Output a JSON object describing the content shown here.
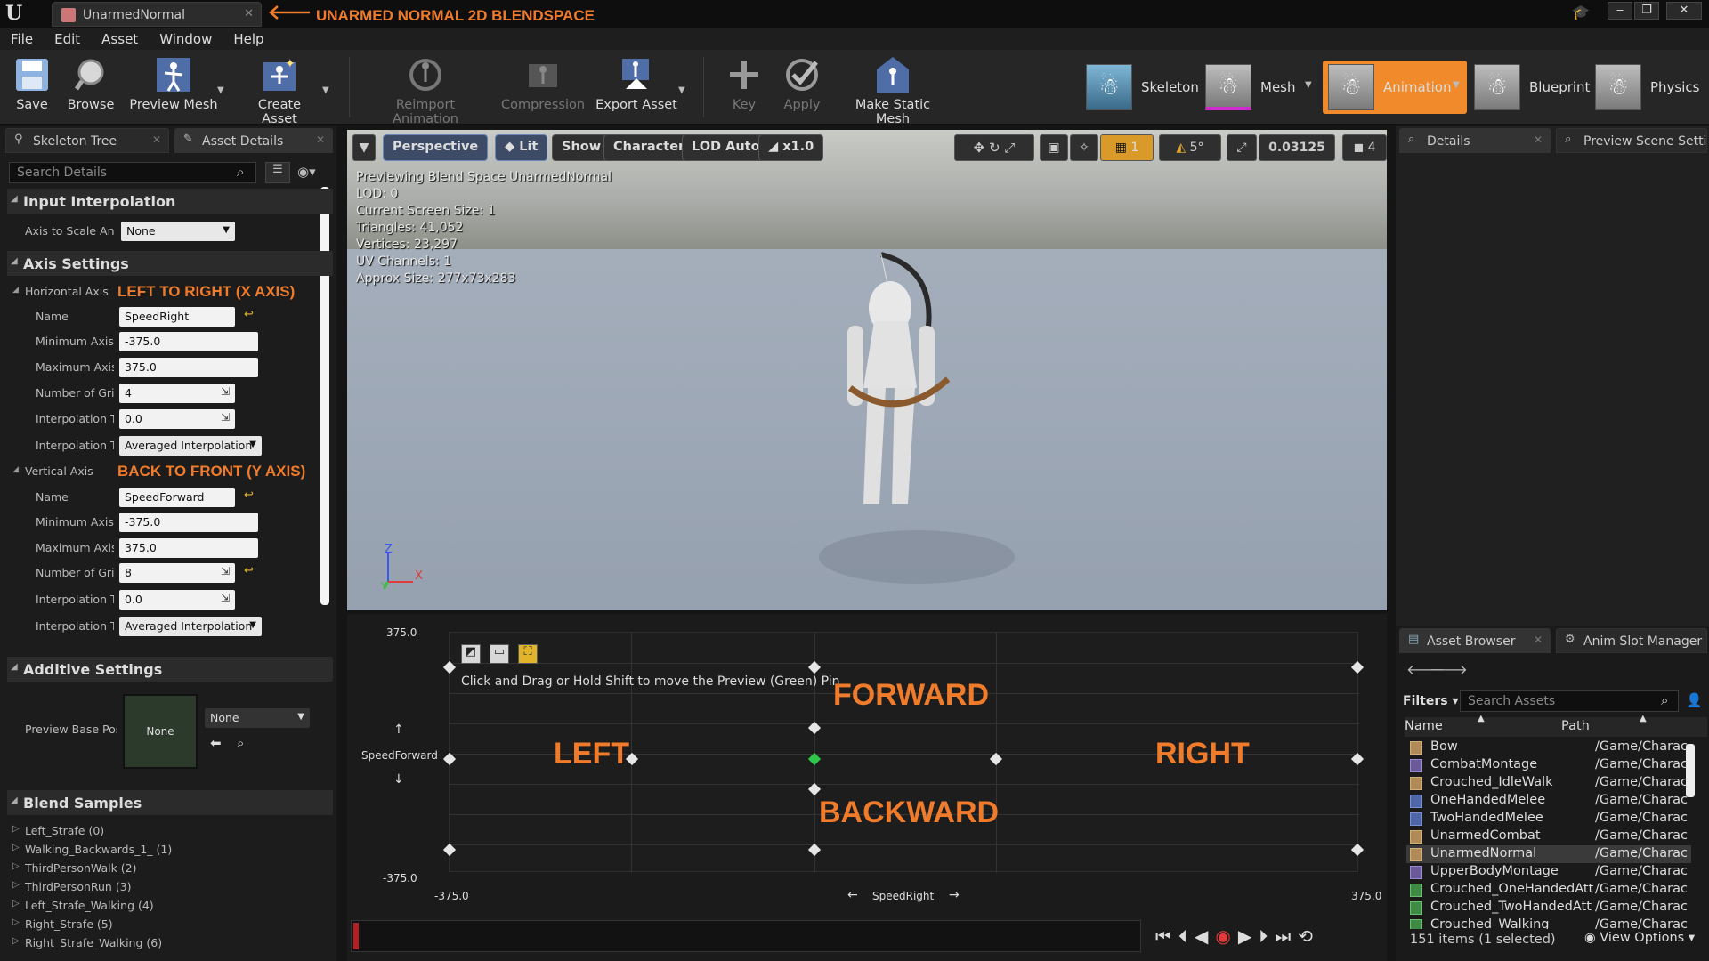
{
  "window": {
    "tab_title": "UnarmedNormal",
    "annotation": "UNARMED NORMAL 2D BLENDSPACE",
    "logo": "U"
  },
  "menu": [
    "File",
    "Edit",
    "Asset",
    "Window",
    "Help"
  ],
  "toolbar": {
    "buttons": [
      {
        "label": "Save",
        "icon": "save-icon"
      },
      {
        "label": "Browse",
        "icon": "browse-icon"
      },
      {
        "label": "Preview Mesh",
        "icon": "preview-mesh-icon"
      },
      {
        "label": "Create Asset",
        "icon": "create-asset-icon"
      },
      {
        "label": "Reimport Animation",
        "icon": "reimport-icon"
      },
      {
        "label": "Compression",
        "icon": "compression-icon"
      },
      {
        "label": "Export Asset",
        "icon": "export-icon"
      },
      {
        "label": "Key",
        "icon": "key-icon"
      },
      {
        "label": "Apply",
        "icon": "apply-icon"
      },
      {
        "label": "Make Static Mesh",
        "icon": "static-mesh-icon"
      }
    ],
    "modes": [
      "Skeleton",
      "Mesh",
      "Animation",
      "Blueprint",
      "Physics"
    ],
    "active_mode": "Animation"
  },
  "left_panel": {
    "tabs": [
      "Skeleton Tree",
      "Asset Details"
    ],
    "search_placeholder": "Search Details",
    "input_interpolation": {
      "title": "Input Interpolation",
      "axis_to_scale_label": "Axis to Scale Anim",
      "axis_to_scale_value": "None"
    },
    "axis_settings": {
      "title": "Axis Settings",
      "horizontal": {
        "label": "Horizontal Axis",
        "annotation": "LEFT TO RIGHT (X AXIS)",
        "name_label": "Name",
        "name": "SpeedRight",
        "min_label": "Minimum Axis Value",
        "min": "-375.0",
        "max_label": "Maximum Axis Value",
        "max": "375.0",
        "grid_label": "Number of Grid Divisions",
        "grid": "4",
        "interp_time_label": "Interpolation Time",
        "interp_time": "0.0",
        "interp_type_label": "Interpolation Type",
        "interp_type": "Averaged Interpolation"
      },
      "vertical": {
        "label": "Vertical Axis",
        "annotation": "BACK TO FRONT (Y AXIS)",
        "name_label": "Name",
        "name": "SpeedForward",
        "min_label": "Minimum Axis Value",
        "min": "-375.0",
        "max_label": "Maximum Axis Value",
        "max": "375.0",
        "grid_label": "Number of Grid Divisions",
        "grid": "8",
        "interp_time_label": "Interpolation Time",
        "interp_time": "0.0",
        "interp_type_label": "Interpolation Type",
        "interp_type": "Averaged Interpolation"
      }
    },
    "additive_settings": {
      "title": "Additive Settings",
      "preview_label": "Preview Base Pose",
      "thumb_text": "None",
      "combo_value": "None"
    },
    "blend_samples": {
      "title": "Blend Samples",
      "items": [
        "Left_Strafe (0)",
        "Walking_Backwards_1_ (1)",
        "ThirdPersonWalk (2)",
        "ThirdPersonRun (3)",
        "Left_Strafe_Walking (4)",
        "Right_Strafe (5)",
        "Right_Strafe_Walking (6)"
      ]
    }
  },
  "viewport": {
    "buttons": [
      "Perspective",
      "Lit",
      "Show",
      "Character",
      "LOD Auto",
      "x1.0"
    ],
    "grid_snap": "1",
    "rot_snap": "5°",
    "scale_snap": "0.03125",
    "cam_speed": "4",
    "stats": [
      "Previewing Blend Space UnarmedNormal",
      "LOD: 0",
      "Current Screen Size: 1",
      "Triangles: 41,052",
      "Vertices: 23,297",
      "UV Channels: 1",
      "Approx Size: 277x73x283"
    ],
    "axis_z": "Z",
    "axis_x": "X",
    "axis_y": "Y"
  },
  "blendspace": {
    "y_max": "375.0",
    "y_min": "-375.0",
    "x_min": "-375.0",
    "x_max": "375.0",
    "x_label": "SpeedRight",
    "y_label": "SpeedForward",
    "hint": "Click and Drag or Hold Shift to move the Preview (Green) Pin",
    "labels": {
      "forward": "FORWARD",
      "backward": "BACKWARD",
      "left": "LEFT",
      "right": "RIGHT"
    }
  },
  "right_panel": {
    "top_tabs": [
      "Details",
      "Preview Scene Settings"
    ],
    "bottom_tabs": [
      "Asset Browser",
      "Anim Slot Manager"
    ],
    "filters": "Filters",
    "search_placeholder": "Search Assets",
    "col_name": "Name",
    "col_path": "Path",
    "assets": [
      {
        "name": "Bow",
        "path": "/Game/Charac",
        "type": "seq"
      },
      {
        "name": "CombatMontage",
        "path": "/Game/Charac",
        "type": "mont"
      },
      {
        "name": "Crouched_IdleWalk",
        "path": "/Game/Charac",
        "type": "seq"
      },
      {
        "name": "OneHandedMelee",
        "path": "/Game/Charac",
        "type": "blue"
      },
      {
        "name": "TwoHandedMelee",
        "path": "/Game/Charac",
        "type": "blue"
      },
      {
        "name": "UnarmedCombat",
        "path": "/Game/Charac",
        "type": "seq"
      },
      {
        "name": "UnarmedNormal",
        "path": "/Game/Charac",
        "type": "seq"
      },
      {
        "name": "UpperBodyMontage",
        "path": "/Game/Charac",
        "type": "mont"
      },
      {
        "name": "Crouched_OneHandedAtt",
        "path": "/Game/Charac",
        "type": "green"
      },
      {
        "name": "Crouched_TwoHandedAtt",
        "path": "/Game/Charac",
        "type": "green"
      },
      {
        "name": "Crouched_Walking",
        "path": "/Game/Charac",
        "type": "green"
      }
    ],
    "selected_asset": "UnarmedNormal",
    "item_count": "151 items (1 selected)",
    "view_options": "View Options"
  }
}
